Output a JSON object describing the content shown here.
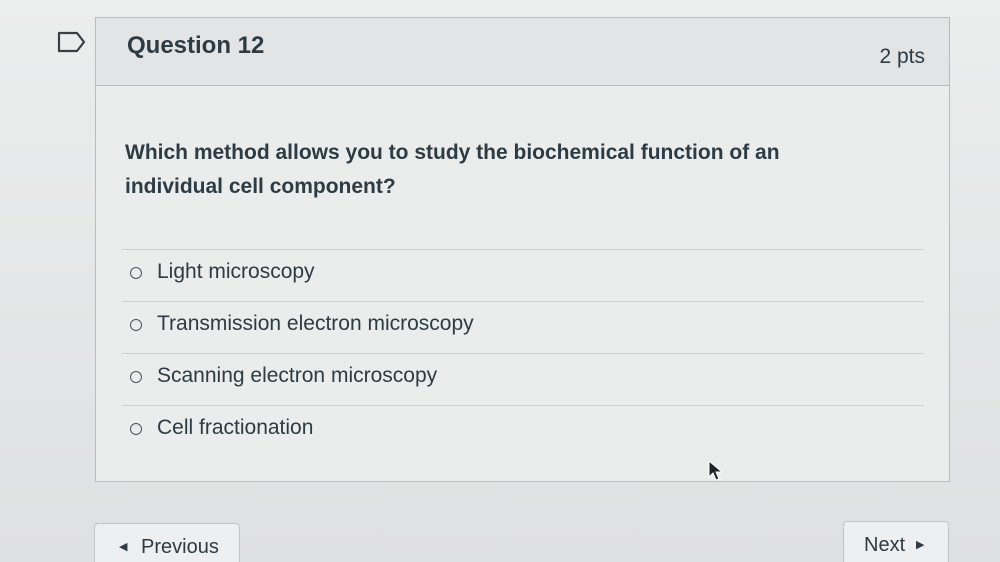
{
  "question": {
    "title": "Question 12",
    "points": "2 pts",
    "text": "Which method allows you to study the biochemical function of an individual cell component?",
    "answers": [
      {
        "label": "Light microscopy"
      },
      {
        "label": "Transmission electron microscopy"
      },
      {
        "label": "Scanning electron microscopy"
      },
      {
        "label": "Cell fractionation"
      }
    ]
  },
  "navigation": {
    "previous_label": "Previous",
    "next_label": "Next"
  },
  "colors": {
    "text": "#2d3b45",
    "border": "#b9bcbf"
  },
  "icons": {
    "flag": "flag-icon",
    "previous_arrow": "triangle-left-icon",
    "next_arrow": "triangle-right-icon",
    "cursor": "mouse-pointer-icon"
  }
}
